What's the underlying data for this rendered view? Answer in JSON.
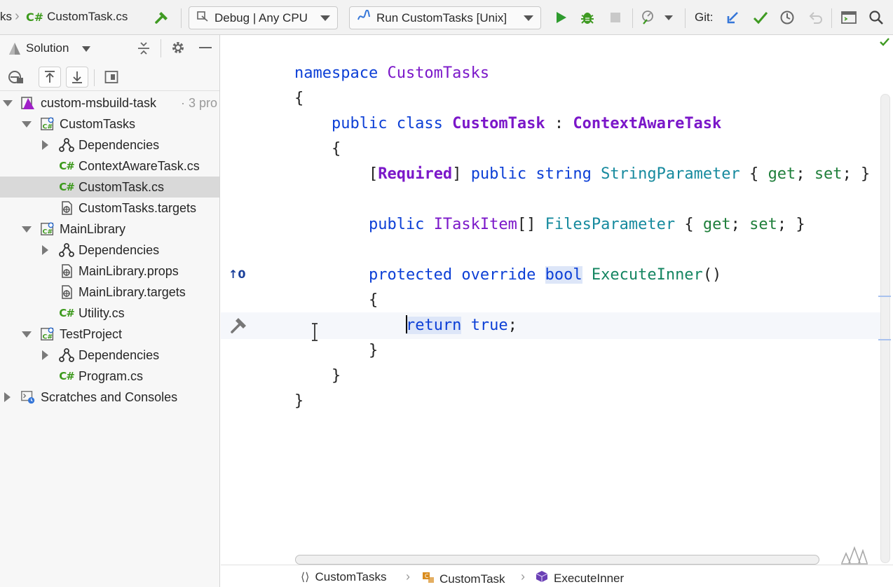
{
  "toolbar": {
    "prev_crumb": "ks",
    "file_tag": "C#",
    "file_name": "CustomTask.cs",
    "config": "Debug | Any CPU",
    "run_config": "Run CustomTasks [Unix]",
    "git_label": "Git:",
    "icons": [
      "hammer-icon",
      "run-icon",
      "debug-icon",
      "stop-icon",
      "profiler-icon",
      "git-update-icon",
      "git-commit-icon",
      "git-history-icon",
      "git-rollback-icon",
      "terminal-icon",
      "search-icon"
    ],
    "colors": {
      "run": "#2e9b2e",
      "debug": "#3f9a22",
      "git_update": "#3576d8",
      "git_commit": "#3f9a22"
    }
  },
  "sidebar": {
    "title": "Solution",
    "tree": [
      {
        "label": "custom-msbuild-task",
        "suffix": "· 3 pro",
        "icon": "solution-icon",
        "level": 0,
        "expanded": true
      },
      {
        "label": "CustomTasks",
        "icon": "csharp-project-icon",
        "level": 1,
        "expanded": true
      },
      {
        "label": "Dependencies",
        "icon": "dependencies-icon",
        "level": 2,
        "expanded": false
      },
      {
        "label": "ContextAwareTask.cs",
        "icon": "csharp-file-icon",
        "level": 2
      },
      {
        "label": "CustomTask.cs",
        "icon": "csharp-file-icon",
        "level": 2,
        "selected": true
      },
      {
        "label": "CustomTasks.targets",
        "icon": "msbuild-file-icon",
        "level": 2
      },
      {
        "label": "MainLibrary",
        "icon": "csharp-project-icon",
        "level": 1,
        "expanded": true
      },
      {
        "label": "Dependencies",
        "icon": "dependencies-icon",
        "level": 2,
        "expanded": false
      },
      {
        "label": "MainLibrary.props",
        "icon": "msbuild-file-icon",
        "level": 2
      },
      {
        "label": "MainLibrary.targets",
        "icon": "msbuild-file-icon",
        "level": 2
      },
      {
        "label": "Utility.cs",
        "icon": "csharp-file-icon",
        "level": 2
      },
      {
        "label": "TestProject",
        "icon": "csharp-project-icon",
        "level": 1,
        "expanded": true
      },
      {
        "label": "Dependencies",
        "icon": "dependencies-icon",
        "level": 2,
        "expanded": false
      },
      {
        "label": "Program.cs",
        "icon": "csharp-file-icon",
        "level": 2
      },
      {
        "label": "Scratches and Consoles",
        "icon": "scratches-icon",
        "level": 0,
        "expanded": false
      }
    ]
  },
  "editor": {
    "lines": [
      [
        {
          "t": "namespace ",
          "c": "kw"
        },
        {
          "t": "CustomTasks",
          "c": "tyn"
        }
      ],
      [
        {
          "t": "{",
          "c": "pl"
        }
      ],
      [
        {
          "t": "    public class ",
          "c": "kw"
        },
        {
          "t": "CustomTask",
          "c": "ty"
        },
        {
          "t": " : ",
          "c": "pl"
        },
        {
          "t": "ContextAwareTask",
          "c": "ty"
        }
      ],
      [
        {
          "t": "    {",
          "c": "pl"
        }
      ],
      [
        {
          "t": "        [",
          "c": "pl"
        },
        {
          "t": "Required",
          "c": "ty"
        },
        {
          "t": "] ",
          "c": "pl"
        },
        {
          "t": "public string ",
          "c": "kw"
        },
        {
          "t": "StringParameter",
          "c": "prop"
        },
        {
          "t": " { ",
          "c": "pl"
        },
        {
          "t": "get",
          "c": "acc"
        },
        {
          "t": "; ",
          "c": "pl"
        },
        {
          "t": "set",
          "c": "acc"
        },
        {
          "t": "; }",
          "c": "pl"
        }
      ],
      [],
      [
        {
          "t": "        public ",
          "c": "kw"
        },
        {
          "t": "ITaskItem",
          "c": "tyn"
        },
        {
          "t": "[] ",
          "c": "pl"
        },
        {
          "t": "FilesParameter",
          "c": "prop"
        },
        {
          "t": " { ",
          "c": "pl"
        },
        {
          "t": "get",
          "c": "acc"
        },
        {
          "t": "; ",
          "c": "pl"
        },
        {
          "t": "set",
          "c": "acc"
        },
        {
          "t": "; }",
          "c": "pl"
        }
      ],
      [],
      [
        {
          "t": "        protected override ",
          "c": "kw"
        },
        {
          "t": "bool",
          "c": "kw hl"
        },
        {
          "t": " ",
          "c": "pl"
        },
        {
          "t": "ExecuteInner",
          "c": "meth"
        },
        {
          "t": "()",
          "c": "pl"
        }
      ],
      [
        {
          "t": "        {",
          "c": "pl"
        }
      ],
      [
        {
          "t": "            ",
          "c": "pl"
        },
        {
          "t": "return",
          "c": "kw hl",
          "caret": true
        },
        {
          "t": " ",
          "c": "pl"
        },
        {
          "t": "true",
          "c": "kw"
        },
        {
          "t": ";",
          "c": "pl"
        }
      ],
      [
        {
          "t": "        }",
          "c": "pl"
        }
      ],
      [
        {
          "t": "    }",
          "c": "pl"
        }
      ],
      [
        {
          "t": "}",
          "c": "pl"
        }
      ]
    ],
    "gutter_override_count": "0"
  },
  "navbar": {
    "items": [
      {
        "label": "CustomTasks",
        "icon": "namespace-icon"
      },
      {
        "label": "CustomTask",
        "icon": "class-icon"
      },
      {
        "label": "ExecuteInner",
        "icon": "method-icon"
      }
    ]
  }
}
